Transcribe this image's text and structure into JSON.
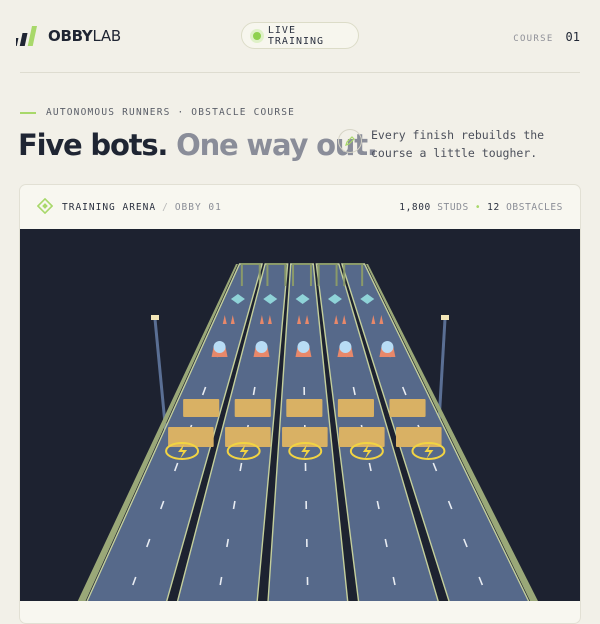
{
  "brand": {
    "name_bold": "OBBY",
    "name_light": "LAB",
    "accent": "#a8d86a"
  },
  "status_pill": {
    "label": "LIVE TRAINING",
    "dot_color": "#8fd14f"
  },
  "course": {
    "label": "COURSE",
    "number": "01"
  },
  "hero": {
    "eyebrow": "AUTONOMOUS RUNNERS · OBSTACLE COURSE",
    "headline_dark": "Five bots.",
    "headline_muted": "One way out.",
    "note_icon": "pencil-icon",
    "note": "Every finish rebuilds the course a little tougher."
  },
  "arena": {
    "icon": "diamond-icon",
    "title": "TRAINING ARENA",
    "separator": "/",
    "subtitle": "OBBY 01",
    "studs_value": "1,800",
    "studs_label": "STUDS",
    "stat_separator": "•",
    "obstacles_value": "12",
    "obstacles_label": "OBSTACLES",
    "lanes": 5,
    "colors": {
      "sky": "#1d2230",
      "track": "#56698a",
      "rail": "#c4cf9c",
      "block": "#d9b164",
      "pad": "#f2d443"
    }
  }
}
